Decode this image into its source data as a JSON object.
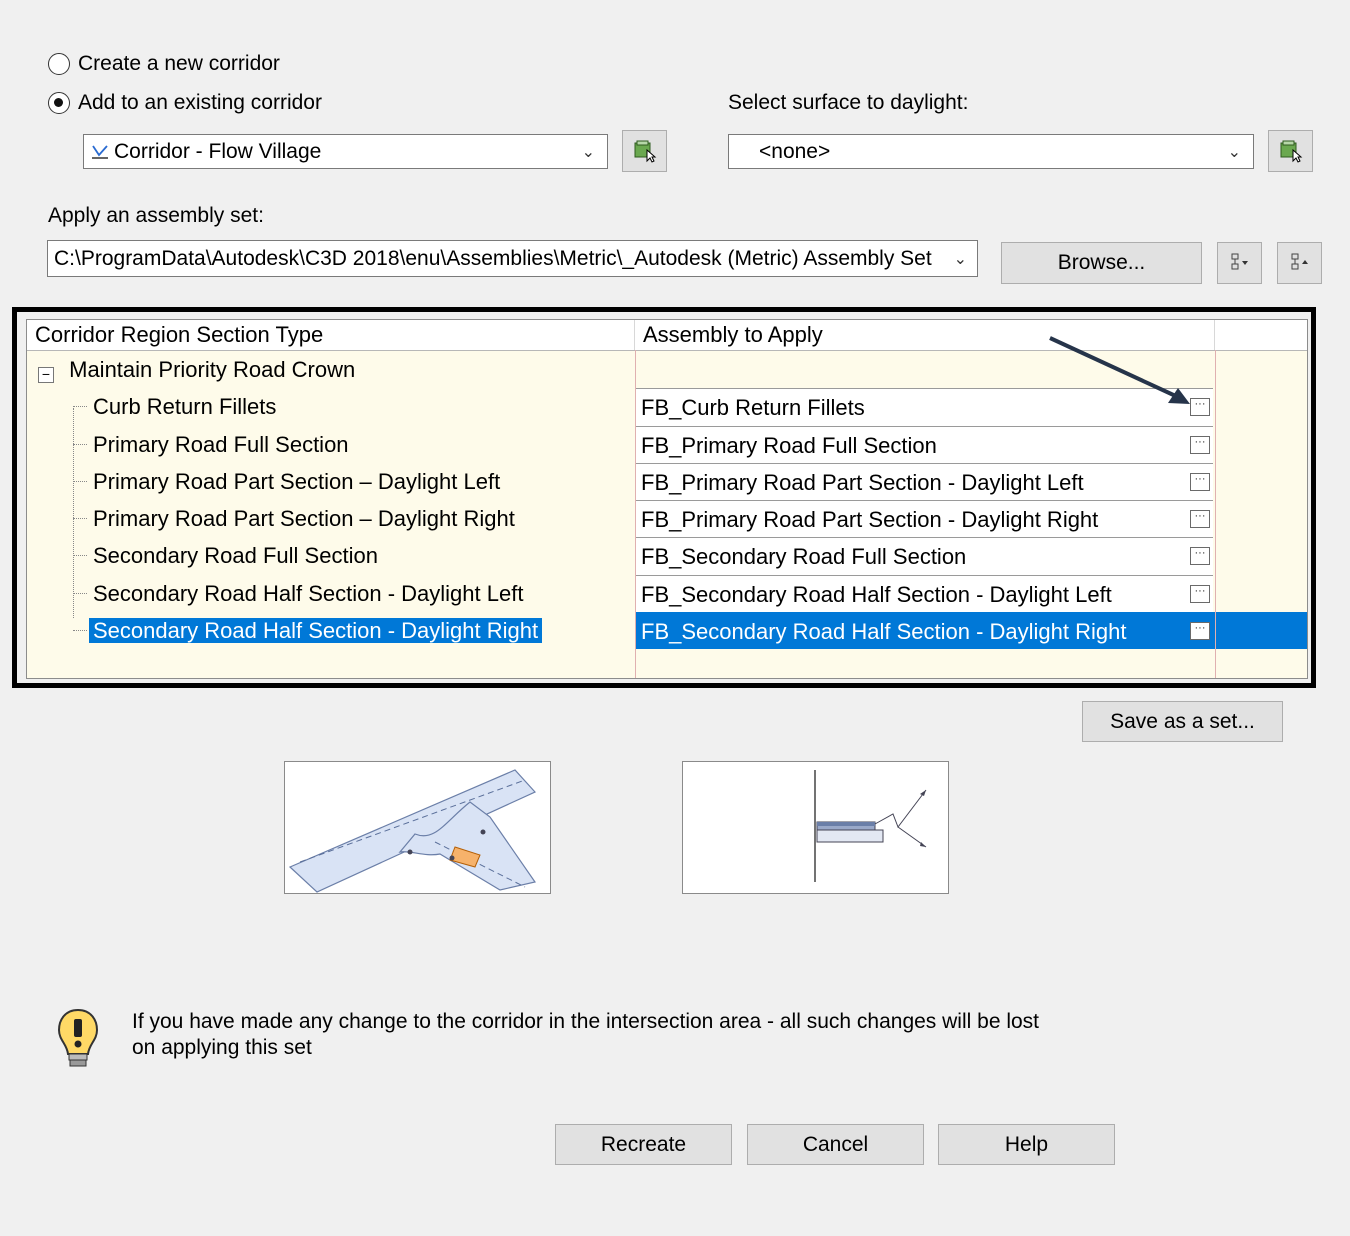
{
  "corridor_mode": {
    "create_label": "Create a new corridor",
    "add_label": "Add to an existing corridor",
    "selected": "add"
  },
  "corridor_combo": {
    "value": "Corridor - Flow Village"
  },
  "daylight": {
    "label": "Select surface to daylight:",
    "value": "<none>"
  },
  "assembly_set": {
    "label": "Apply an assembly set:",
    "path": "C:\\ProgramData\\Autodesk\\C3D 2018\\enu\\Assemblies\\Metric\\_Autodesk (Metric) Assembly Set",
    "browse_label": "Browse..."
  },
  "grid": {
    "col1_header": "Corridor Region Section Type",
    "col2_header": "Assembly to Apply",
    "group": {
      "expander": "⊟",
      "label": "Maintain Priority Road Crown"
    },
    "rows": [
      {
        "type": "Curb Return Fillets",
        "assembly": "FB_Curb Return Fillets"
      },
      {
        "type": "Primary Road Full Section",
        "assembly": "FB_Primary Road Full Section"
      },
      {
        "type": "Primary Road Part Section – Daylight Left",
        "assembly": "FB_Primary Road Part Section - Daylight Left"
      },
      {
        "type": "Primary Road Part Section – Daylight Right",
        "assembly": "FB_Primary Road Part Section - Daylight Right"
      },
      {
        "type": "Secondary Road Full Section",
        "assembly": "FB_Secondary Road Full Section"
      },
      {
        "type": "Secondary Road Half Section - Daylight Left",
        "assembly": "FB_Secondary Road Half Section - Daylight Left"
      },
      {
        "type": "Secondary Road Half Section - Daylight Right",
        "assembly": "FB_Secondary Road Half Section - Daylight Right"
      }
    ],
    "selected_row": "Secondary Road Half Section - Daylight Right",
    "ellipsis_glyph": "···"
  },
  "save_set_label": "Save as a set...",
  "message": {
    "line1": "If you have made any change to the corridor in the intersection area - all such changes will be lost",
    "line2": "on applying this set"
  },
  "buttons": {
    "recreate": "Recreate",
    "cancel": "Cancel",
    "help": "Help"
  },
  "colors": {
    "selection": "#0078d7",
    "grid_bg": "#fefbea",
    "dialog_bg": "#f0f0f0"
  },
  "icons": [
    "corridor-icon",
    "pick-from-drawing-icon",
    "tree-collapse-icon",
    "tree-expand-icon",
    "ellipsis-icon",
    "lightbulb-icon",
    "annotation-arrow"
  ]
}
